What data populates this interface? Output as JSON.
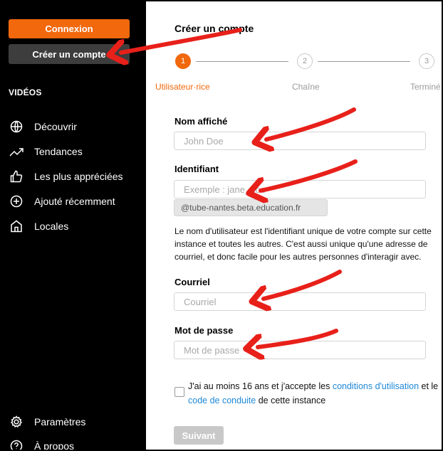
{
  "sidebar": {
    "login_label": "Connexion",
    "create_account_label": "Créer un compte",
    "section_title": "VIDÉOS",
    "items": [
      {
        "label": "Découvrir",
        "icon": "globe-icon"
      },
      {
        "label": "Tendances",
        "icon": "trending-icon"
      },
      {
        "label": "Les plus appréciées",
        "icon": "thumbs-up-icon"
      },
      {
        "label": "Ajouté récemment",
        "icon": "plus-circle-icon"
      },
      {
        "label": "Locales",
        "icon": "home-icon"
      }
    ],
    "footer_items": [
      {
        "label": "Paramètres",
        "icon": "gear-icon"
      },
      {
        "label": "À propos",
        "icon": "help-icon"
      }
    ]
  },
  "main": {
    "title": "Créer un compte",
    "steps": [
      {
        "number": "1",
        "label": "Utilisateur·rice",
        "state": "active"
      },
      {
        "number": "2",
        "label": "Chaîne",
        "state": "todo"
      },
      {
        "number": "3",
        "label": "Terminé",
        "state": "todo"
      }
    ],
    "fields": {
      "display_name": {
        "label": "Nom affiché",
        "placeholder": "John Doe",
        "value": ""
      },
      "username": {
        "label": "Identifiant",
        "placeholder": "Exemple : jane_doe",
        "value": "",
        "suffix": "@tube-nantes.beta.education.fr"
      },
      "email": {
        "label": "Courriel",
        "placeholder": "Courriel",
        "value": ""
      },
      "password": {
        "label": "Mot de passe",
        "placeholder": "Mot de passe",
        "value": ""
      }
    },
    "username_help": "Le nom d'utilisateur est l'identifiant unique de votre compte sur cette instance et toutes les autres. C'est aussi unique qu'une adresse de courriel, et donc facile pour les autres personnes d'interagir avec.",
    "terms": {
      "prefix": "J'ai au moins 16 ans et j'accepte les ",
      "link1": "conditions d'utilisation",
      "middle1": " et le ",
      "link2": "code de conduite",
      "suffix": " de cette instance",
      "checked": false
    },
    "next_label": "Suivant"
  },
  "colors": {
    "accent": "#f1680d",
    "sidebar_bg": "#000000",
    "link": "#1e88d8",
    "annotation": "#e8201a"
  }
}
